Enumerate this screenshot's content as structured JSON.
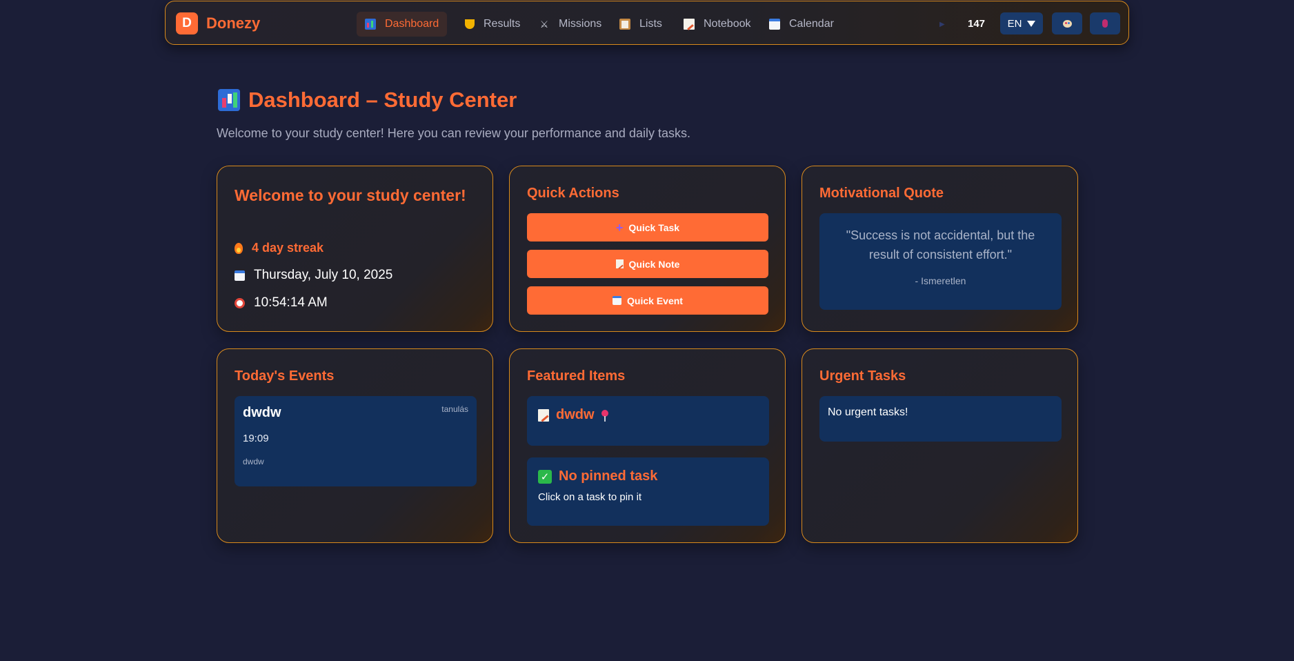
{
  "app": {
    "logo_letter": "D",
    "name": "Donezy"
  },
  "nav": {
    "items": [
      {
        "label": "Dashboard",
        "icon": "chart-icon",
        "active": true
      },
      {
        "label": "Results",
        "icon": "trophy-icon"
      },
      {
        "label": "Missions",
        "icon": "swords-icon"
      },
      {
        "label": "Lists",
        "icon": "clipboard-icon"
      },
      {
        "label": "Notebook",
        "icon": "memo-icon"
      },
      {
        "label": "Calendar",
        "icon": "calendar-icon"
      }
    ],
    "points": "147",
    "language": "EN"
  },
  "header": {
    "title": "Dashboard – Study Center",
    "subtitle": "Welcome to your study center! Here you can review your performance and daily tasks."
  },
  "welcome_card": {
    "title": "Welcome to your study center!",
    "streak": "4 day streak",
    "date": "Thursday, July 10, 2025",
    "time": "10:54:14 AM"
  },
  "quick_actions": {
    "title": "Quick Actions",
    "task_label": "Quick Task",
    "note_label": "Quick Note",
    "event_label": "Quick Event"
  },
  "quote_card": {
    "title": "Motivational Quote",
    "quote": "\"Success is not accidental, but the result of consistent effort.\"",
    "author": "- Ismeretlen"
  },
  "events_card": {
    "title": "Today's Events",
    "event": {
      "title": "dwdw",
      "tag": "tanulás",
      "time": "19:09",
      "description": "dwdw"
    }
  },
  "featured_card": {
    "title": "Featured Items",
    "note_title": "dwdw",
    "pinned_title": "No pinned task",
    "pinned_hint": "Click on a task to pin it"
  },
  "urgent_card": {
    "title": "Urgent Tasks",
    "empty_text": "No urgent tasks!"
  },
  "colors": {
    "accent": "#ff6b35",
    "border": "#d98a1c",
    "panel": "#12305c",
    "background": "#1b1e37"
  }
}
